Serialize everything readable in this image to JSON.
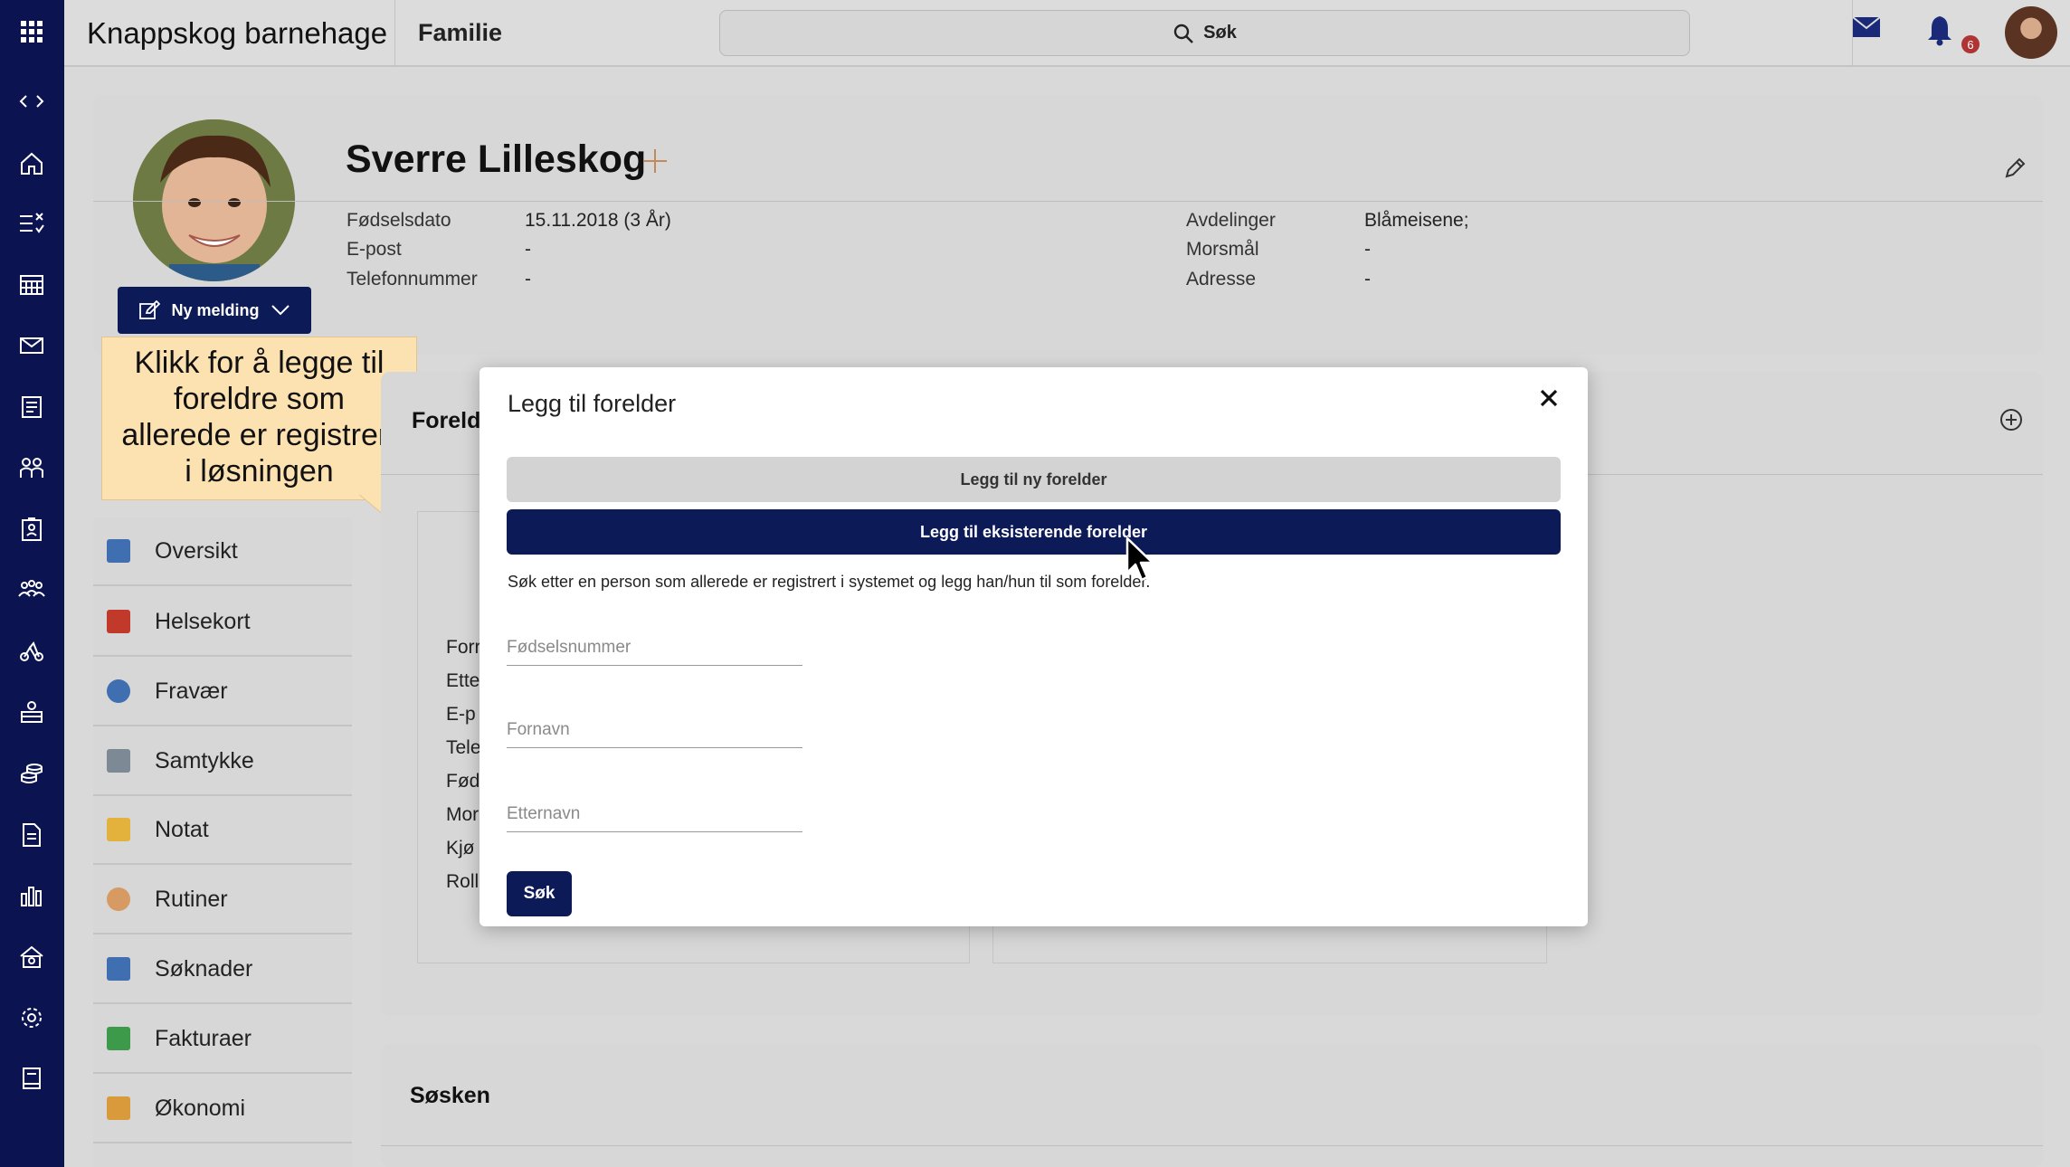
{
  "header": {
    "organization": "Knappskog barnehage",
    "section": "Familie",
    "search_label": "Søk",
    "notification_count": "6"
  },
  "rail": {
    "icons": [
      "apps-grid-icon",
      "expand-collapse-icon",
      "home-icon",
      "checklist-icon",
      "calendar-icon",
      "mail-icon",
      "news-icon",
      "children-icon",
      "attendance-icon",
      "groups-icon",
      "activities-icon",
      "room-icon",
      "finance-icon",
      "document-icon",
      "statistics-icon",
      "kindergarten-icon",
      "settings-icon",
      "guide-icon"
    ]
  },
  "profile": {
    "name": "Sverre Lilleskog",
    "fields_left": [
      {
        "label": "Fødselsdato",
        "value": "15.11.2018 (3 År)"
      },
      {
        "label": "E-post",
        "value": "-"
      },
      {
        "label": "Telefonnummer",
        "value": "-"
      }
    ],
    "fields_right": [
      {
        "label": "Avdelinger",
        "value": "Blåmeisene;"
      },
      {
        "label": "Morsmål",
        "value": "-"
      },
      {
        "label": "Adresse",
        "value": "-"
      }
    ],
    "new_message_label": "Ny melding"
  },
  "callout": {
    "lines": [
      "Klikk for å legge til",
      "foreldre som",
      "allerede er registrert",
      "i løsningen"
    ]
  },
  "sidenav": {
    "items": [
      {
        "label": "Oversikt",
        "color": "#3f6fb0"
      },
      {
        "label": "Helsekort",
        "color": "#c0392b"
      },
      {
        "label": "Fravær",
        "color": "#3f6fb0"
      },
      {
        "label": "Samtykke",
        "color": "#7d8a96"
      },
      {
        "label": "Notat",
        "color": "#e3b23c"
      },
      {
        "label": "Rutiner",
        "color": "#d69a62"
      },
      {
        "label": "Søknader",
        "color": "#3f6fb0"
      },
      {
        "label": "Fakturaer",
        "color": "#3d9a4a"
      },
      {
        "label": "Økonomi",
        "color": "#d89a3a"
      }
    ]
  },
  "parents_section": {
    "title_visible": "Foreldr",
    "field_fragments": [
      "Forr",
      "Ette",
      "E-p",
      "Tele",
      "Fød",
      "Mor",
      "Kjø",
      "Roll"
    ]
  },
  "siblings_section": {
    "title": "Søsken"
  },
  "modal": {
    "title": "Legg til forelder",
    "btn_new": "Legg til ny forelder",
    "btn_existing": "Legg til eksisterende forelder",
    "description": "Søk etter en person som allerede er registrert i systemet og legg han/hun til som forelder.",
    "fields": [
      {
        "placeholder": "Fødselsnummer"
      },
      {
        "placeholder": "Fornavn"
      },
      {
        "placeholder": "Etternavn"
      }
    ],
    "search_button": "Søk"
  },
  "colors": {
    "rail": "#0b1450",
    "primary": "#0d1a58",
    "callout": "#fde2b1",
    "badge": "#b03434"
  }
}
